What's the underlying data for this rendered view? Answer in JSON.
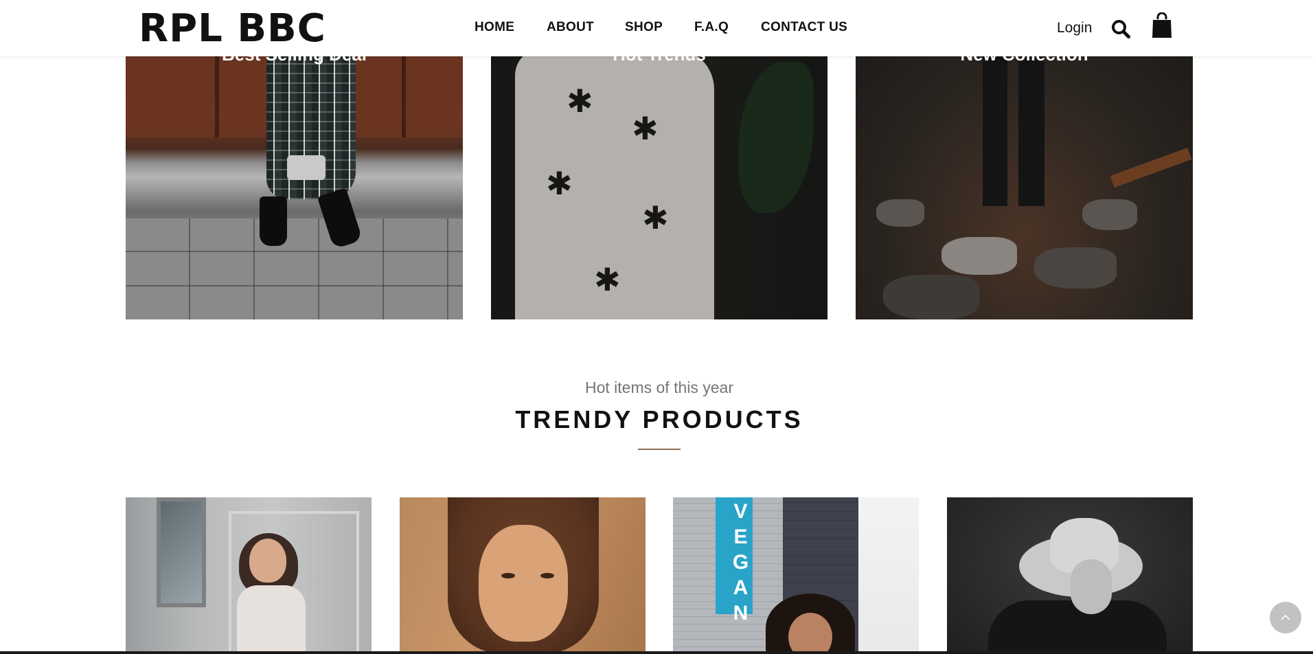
{
  "header": {
    "logo": "RPL BBC",
    "nav": [
      {
        "label": "HOME"
      },
      {
        "label": "ABOUT"
      },
      {
        "label": "SHOP"
      },
      {
        "label": "F.A.Q"
      },
      {
        "label": "CONTACT US"
      }
    ],
    "login_label": "Login",
    "icons": {
      "search": "search-icon",
      "cart": "shopping-bag-icon"
    }
  },
  "banners": [
    {
      "title": "Best Selling Deal"
    },
    {
      "title": "Hot Trends"
    },
    {
      "title": "New Collection"
    }
  ],
  "section": {
    "subtitle": "Hot items of this year",
    "title": "TRENDY PRODUCTS",
    "accent_color": "#8c6f56"
  },
  "products": [
    {
      "sign_text": ""
    },
    {
      "sign_text": ""
    },
    {
      "sign_text": "VEGAN"
    },
    {
      "sign_text": ""
    }
  ],
  "scroll_top": {
    "icon": "chevron-up-icon"
  }
}
